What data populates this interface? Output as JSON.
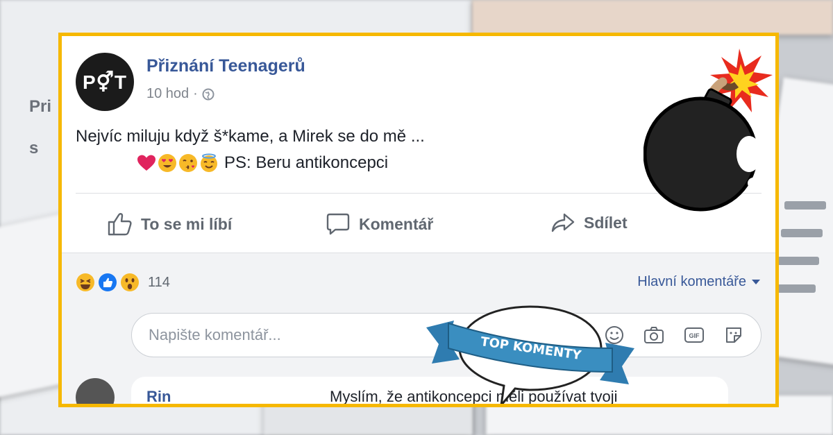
{
  "post": {
    "page_name": "Přiznání Teenagerů",
    "avatar_text": "P⚥T",
    "time": "10 hod",
    "separator": "·",
    "text_line1": "Nejvíc miluju když š*kame, a Mirek se do mě ...",
    "text_line2": "PS: Beru antikoncepci"
  },
  "actions": {
    "like_label": "To se mi líbí",
    "comment_label": "Komentář",
    "share_label": "Sdílet"
  },
  "reactions": {
    "count": "114"
  },
  "comments": {
    "sort_label": "Hlavní komentáře",
    "input_placeholder": "Napište komentář...",
    "first_name": "Rin",
    "first_text": "Myslím, že antikoncepci měli používat tvoji"
  },
  "badge": {
    "text": "TOP KOMENTY"
  },
  "colors": {
    "frame": "#f6b800",
    "link": "#385898",
    "badge_ribbon": "#3a8ec0"
  }
}
